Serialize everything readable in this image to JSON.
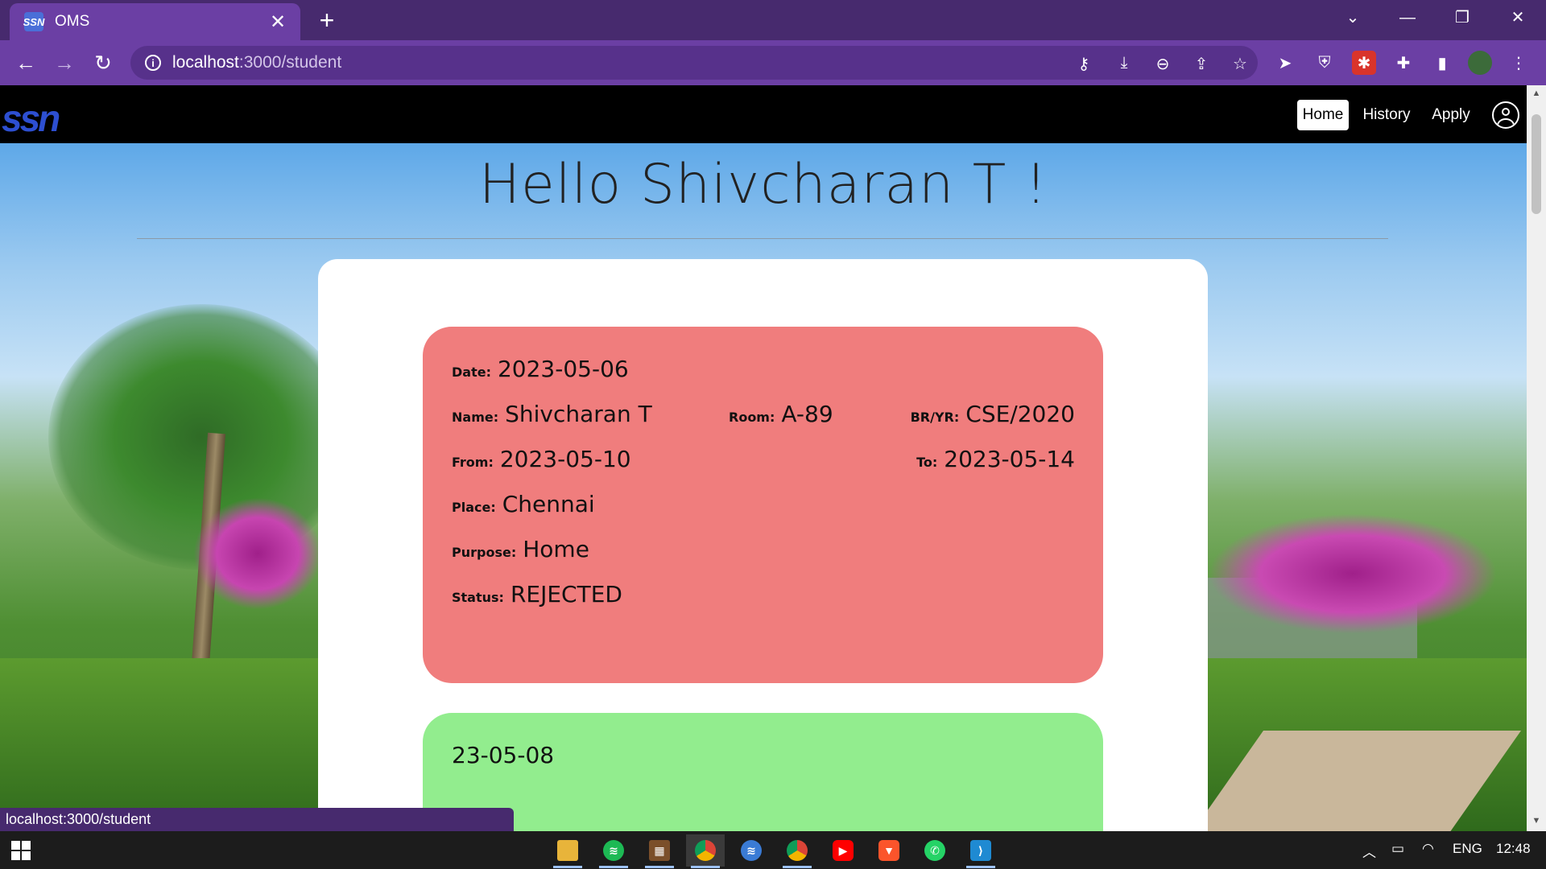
{
  "browser": {
    "tab_title": "OMS",
    "tab_favicon_text": "SSN",
    "url_host": "localhost",
    "url_rest": ":3000/student",
    "status_url": "localhost:3000/student",
    "icons": [
      "back-icon",
      "forward-icon",
      "reload-icon",
      "key-icon",
      "install-icon",
      "zoom-out-icon",
      "share-icon",
      "star-icon",
      "cursor-extension-icon",
      "shield-extension-icon",
      "puzzle-extension-icon",
      "extensions-icon",
      "side-panel-icon",
      "profile-avatar-icon",
      "menu-icon"
    ]
  },
  "navbar": {
    "logo": "ssn",
    "links": [
      "Home",
      "History",
      "Apply"
    ],
    "active": "Home"
  },
  "greeting": "Hello Shivcharan T !",
  "cards": [
    {
      "status_color": "#f07d7d",
      "date_label": "Date:",
      "date": "2023-05-06",
      "name_label": "Name:",
      "name": "Shivcharan T",
      "room_label": "Room:",
      "room": "A-89",
      "bryr_label": "BR/YR:",
      "bryr": "CSE/2020",
      "from_label": "From:",
      "from": "2023-05-10",
      "to_label": "To:",
      "to": "2023-05-14",
      "place_label": "Place:",
      "place": "Chennai",
      "purpose_label": "Purpose:",
      "purpose": "Home",
      "status_label": "Status:",
      "status": "REJECTED"
    },
    {
      "status_color": "#92ed8e",
      "date_partial": "23-05-08"
    }
  ],
  "taskbar": {
    "apps": [
      "file-explorer",
      "spotify",
      "winrar",
      "chrome",
      "spotify-alt",
      "chrome-alt",
      "youtube",
      "brave",
      "whatsapp",
      "vscode"
    ],
    "language": "ENG",
    "time": "12:48"
  }
}
